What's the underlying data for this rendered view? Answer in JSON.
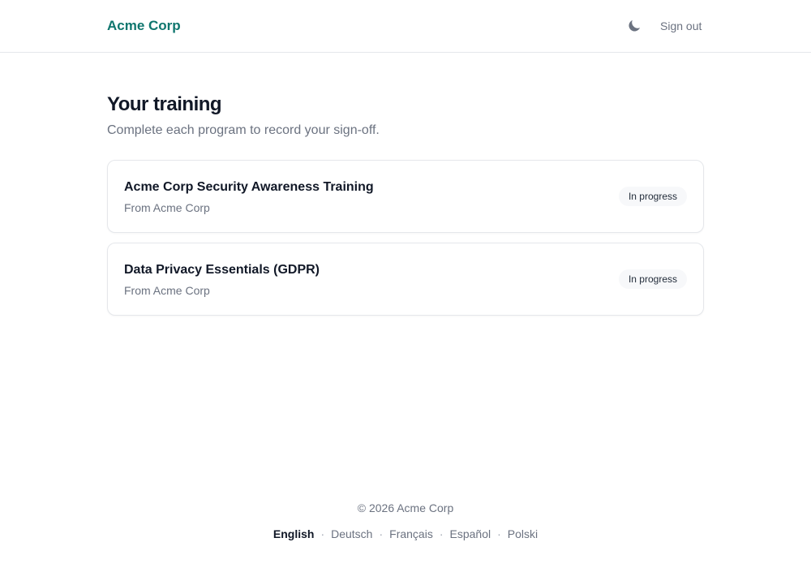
{
  "header": {
    "brand": "Acme Corp",
    "theme_icon": "moon-icon",
    "signout_label": "Sign out"
  },
  "main": {
    "title": "Your training",
    "subtitle": "Complete each program to record your sign-off.",
    "programs": [
      {
        "title": "Acme Corp Security Awareness Training",
        "from": "From Acme Corp",
        "status": "In progress"
      },
      {
        "title": "Data Privacy Essentials (GDPR)",
        "from": "From Acme Corp",
        "status": "In progress"
      }
    ]
  },
  "footer": {
    "copyright": "© 2026 Acme Corp",
    "separator": "·",
    "languages": [
      {
        "label": "English",
        "active": true
      },
      {
        "label": "Deutsch",
        "active": false
      },
      {
        "label": "Français",
        "active": false
      },
      {
        "label": "Español",
        "active": false
      },
      {
        "label": "Polski",
        "active": false
      }
    ]
  },
  "colors": {
    "brand": "#0f766e",
    "text": "#111827",
    "muted": "#6b7280",
    "border": "#e5e7eb",
    "badge_bg": "#f7f8fa"
  }
}
